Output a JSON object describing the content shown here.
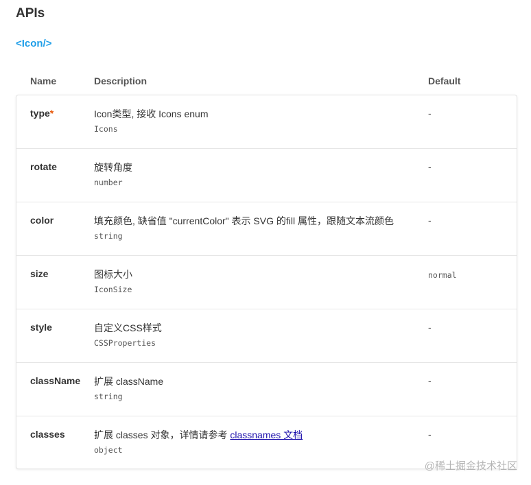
{
  "page": {
    "title": "APIs",
    "component": "<Icon/>"
  },
  "table": {
    "headers": {
      "name": "Name",
      "description": "Description",
      "default": "Default"
    },
    "rows": [
      {
        "name": "type",
        "required_mark": "*",
        "desc": "Icon类型, 接收 Icons enum",
        "type": "Icons",
        "default": "-"
      },
      {
        "name": "rotate",
        "required_mark": "",
        "desc": "旋转角度",
        "type": "number",
        "default": "-"
      },
      {
        "name": "color",
        "required_mark": "",
        "desc": "填充颜色, 缺省值 \"currentColor\" 表示 SVG 的fill 属性，跟随文本流颜色",
        "type": "string",
        "default": "-"
      },
      {
        "name": "size",
        "required_mark": "",
        "desc": "图标大小",
        "type": "IconSize",
        "default": "normal"
      },
      {
        "name": "style",
        "required_mark": "",
        "desc": "自定义CSS样式",
        "type": "CSSProperties",
        "default": "-"
      },
      {
        "name": "className",
        "required_mark": "",
        "desc": "扩展 className",
        "type": "string",
        "default": "-"
      },
      {
        "name": "classes",
        "required_mark": "",
        "desc": "扩展 classes 对象，详情请参考 ",
        "link": "classnames 文档",
        "type": "object",
        "default": "-"
      }
    ]
  },
  "watermark": "@稀土掘金技术社区",
  "colors": {
    "accent": "#1f9ee8",
    "required": "#e8590c",
    "link": "#1a0dab"
  }
}
